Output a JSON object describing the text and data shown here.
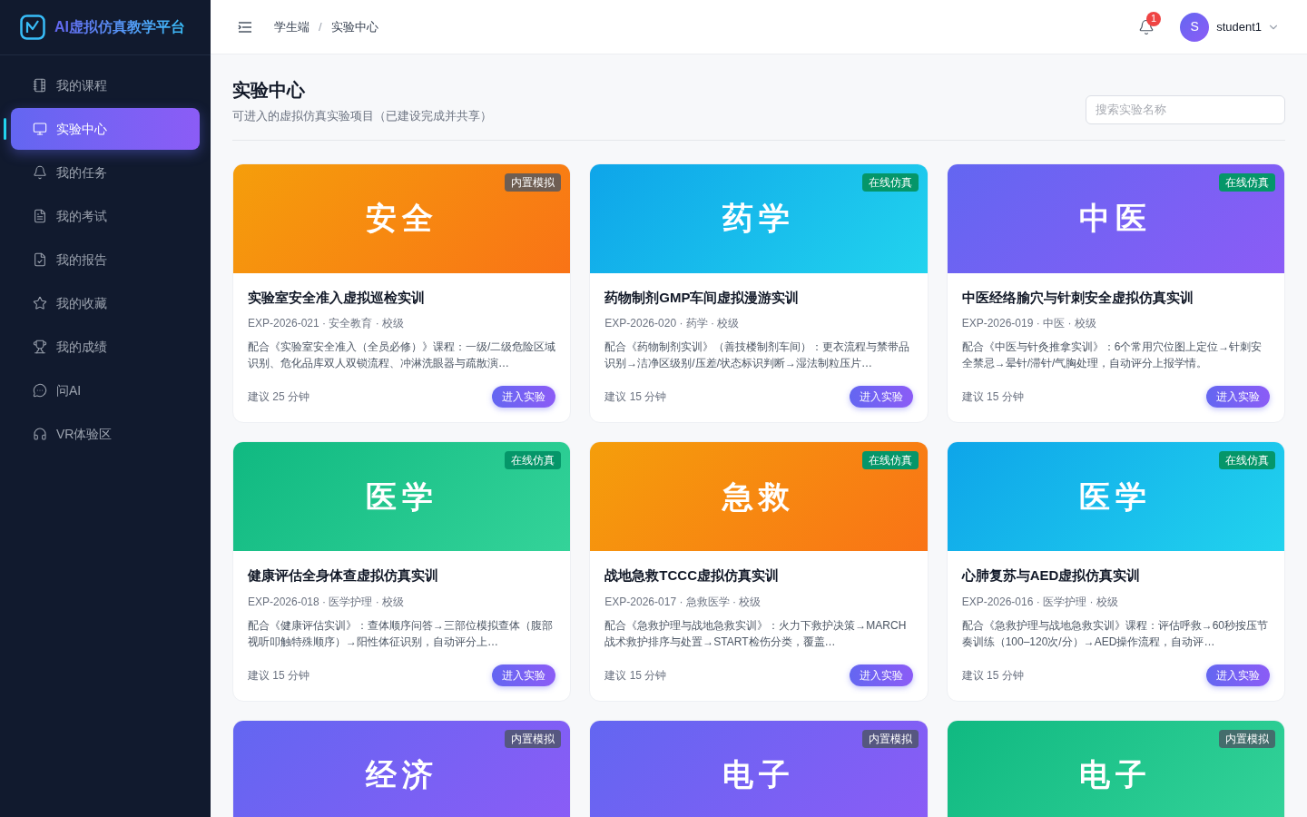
{
  "brand": {
    "title": "AI虚拟仿真教学平台"
  },
  "sidebar": {
    "items": [
      {
        "label": "我的课程",
        "selected": false
      },
      {
        "label": "实验中心",
        "selected": true
      },
      {
        "label": "我的任务",
        "selected": false
      },
      {
        "label": "我的考试",
        "selected": false
      },
      {
        "label": "我的报告",
        "selected": false
      },
      {
        "label": "我的收藏",
        "selected": false
      },
      {
        "label": "我的成绩",
        "selected": false
      },
      {
        "label": "问AI",
        "selected": false
      },
      {
        "label": "VR体验区",
        "selected": false
      }
    ]
  },
  "header": {
    "breadcrumb": [
      "学生端",
      "实验中心"
    ],
    "separator": "/",
    "notifications": "1",
    "avatar": "S",
    "user": "student1"
  },
  "page": {
    "title": "实验中心",
    "subtitle": "可进入的虚拟仿真实验项目（已建设完成并共享）",
    "search": {
      "placeholder": "搜索实验名称"
    }
  },
  "cards": [
    {
      "banner": "安全",
      "color": "#f59e0b",
      "badge": {
        "label": "内置模拟",
        "kind": "builtin"
      },
      "title": "实验室安全准入虚拟巡检实训",
      "meta": "EXP-2026-021 · 安全教育 · 校级",
      "description": "配合《实验室安全准入（全员必修）》课程：一级/二级危险区域识别、危化品库双人双锁流程、冲淋洗眼器与疏散演…",
      "duration": "建议 25 分钟",
      "action": "进入实验"
    },
    {
      "banner": "药学",
      "color": "#0ea5e9",
      "badge": {
        "label": "在线仿真",
        "kind": "online"
      },
      "title": "药物制剂GMP车间虚拟漫游实训",
      "meta": "EXP-2026-020 · 药学 · 校级",
      "description": "配合《药物制剂实训》（善技楼制剂车间）：更衣流程与禁带品识别→洁净区级别/压差/状态标识判断→湿法制粒压片…",
      "duration": "建议 15 分钟",
      "action": "进入实验"
    },
    {
      "banner": "中医",
      "color": "#6366f1",
      "badge": {
        "label": "在线仿真",
        "kind": "online"
      },
      "title": "中医经络腧穴与针刺安全虚拟仿真实训",
      "meta": "EXP-2026-019 · 中医 · 校级",
      "description": "配合《中医与针灸推拿实训》：6个常用穴位图上定位→针刺安全禁忌→晕针/滞针/气胸处理，自动评分上报学情。",
      "duration": "建议 15 分钟",
      "action": "进入实验"
    },
    {
      "banner": "医学",
      "color": "#10b981",
      "badge": {
        "label": "在线仿真",
        "kind": "online"
      },
      "title": "健康评估全身体查虚拟仿真实训",
      "meta": "EXP-2026-018 · 医学护理 · 校级",
      "description": "配合《健康评估实训》：查体顺序问答→三部位模拟查体（腹部视听叩触特殊顺序）→阳性体征识别，自动评分上…",
      "duration": "建议 15 分钟",
      "action": "进入实验"
    },
    {
      "banner": "急救",
      "color": "#f59e0b",
      "badge": {
        "label": "在线仿真",
        "kind": "online"
      },
      "title": "战地急救TCCC虚拟仿真实训",
      "meta": "EXP-2026-017 · 急救医学 · 校级",
      "description": "配合《急救护理与战地急救实训》：火力下救护决策→MARCH战术救护排序与处置→START检伤分类，覆盖…",
      "duration": "建议 15 分钟",
      "action": "进入实验"
    },
    {
      "banner": "医学",
      "color": "#0ea5e9",
      "badge": {
        "label": "在线仿真",
        "kind": "online"
      },
      "title": "心肺复苏与AED虚拟仿真实训",
      "meta": "EXP-2026-016 · 医学护理 · 校级",
      "description": "配合《急救护理与战地急救实训》课程：评估呼救→60秒按压节奏训练（100–120次/分）→AED操作流程，自动评…",
      "duration": "建议 15 分钟",
      "action": "进入实验"
    },
    {
      "banner": "经济",
      "color": "#6366f1",
      "badge": {
        "label": "内置模拟",
        "kind": "builtin"
      }
    },
    {
      "banner": "电子",
      "color": "#6366f1",
      "badge": {
        "label": "内置模拟",
        "kind": "builtin"
      }
    },
    {
      "banner": "电子",
      "color": "#10b981",
      "badge": {
        "label": "内置模拟",
        "kind": "builtin"
      }
    }
  ]
}
